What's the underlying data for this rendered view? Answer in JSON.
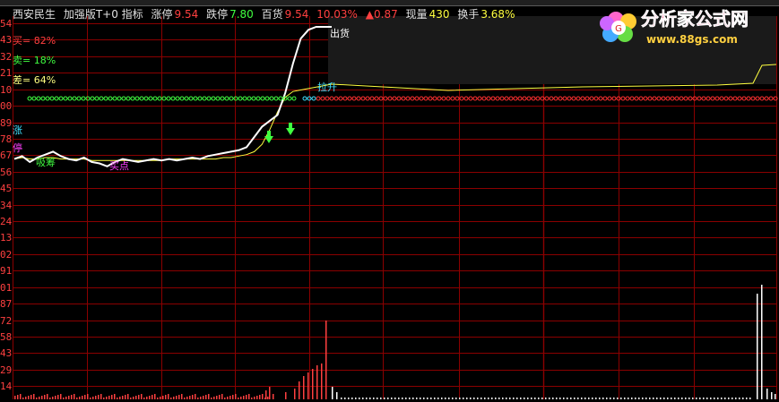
{
  "header": {
    "stock_name": "西安民生",
    "indicator_name": "加强版T+0 指标",
    "limit_up_label": "涨停",
    "limit_up_value": "9.54",
    "limit_down_label": "跌停",
    "limit_down_value": "7.80",
    "baihuo_label": "百货",
    "baihuo_price": "9.54",
    "change_pct": "10.03%",
    "change_value": "▲0.87",
    "volume_label": "现量",
    "volume_value": "430",
    "turnover_label": "换手",
    "turnover_value": "3.68%"
  },
  "indicators": {
    "buy": "买= 82%",
    "sell": "卖= 18%",
    "diff": "差= 64%"
  },
  "annotations": {
    "chuhuo": "出货",
    "lasheng": "拉升",
    "zhang": "涨",
    "ting": "停",
    "xishou": "吸筹",
    "maidian": "买点"
  },
  "logo": {
    "text": "分析家公式网",
    "url": "www.88gs.com"
  },
  "y_axis_labels": [
    "54",
    "43",
    "32",
    "21",
    "10",
    "00",
    "89",
    "78",
    "67",
    "56",
    "45",
    "34",
    "24",
    "13",
    "02",
    "91",
    "01",
    "87",
    "72",
    "58",
    "43",
    "29",
    "14"
  ],
  "colors": {
    "grid": "#8b0000",
    "price_line": "#ffffff",
    "avg_line": "#ffff40",
    "buy_color": "#ff4040",
    "sell_color": "#40ff40",
    "diff_color": "#ffff80",
    "cyan": "#40e0ff",
    "magenta": "#ff40ff"
  },
  "chart_data": {
    "type": "line",
    "price": [
      0.1,
      0.12,
      0.08,
      0.11,
      0.13,
      0.15,
      0.12,
      0.1,
      0.09,
      0.11,
      0.08,
      0.07,
      0.05,
      0.08,
      0.1,
      0.09,
      0.08,
      0.09,
      0.1,
      0.09,
      0.1,
      0.09,
      0.1,
      0.11,
      0.1,
      0.12,
      0.13,
      0.14,
      0.15,
      0.16,
      0.18,
      0.25,
      0.32,
      0.36,
      0.4,
      0.55,
      0.75,
      0.92,
      0.98,
      1.0,
      1.0,
      1.0
    ],
    "avg": [
      0.1,
      0.11,
      0.1,
      0.1,
      0.11,
      0.11,
      0.1,
      0.1,
      0.1,
      0.1,
      0.09,
      0.09,
      0.09,
      0.09,
      0.09,
      0.09,
      0.09,
      0.09,
      0.09,
      0.09,
      0.1,
      0.1,
      0.1,
      0.1,
      0.1,
      0.1,
      0.1,
      0.11,
      0.11,
      0.12,
      0.13,
      0.15,
      0.2,
      0.3,
      0.42,
      0.52,
      0.56,
      0.57,
      0.58,
      0.59,
      0.6,
      0.61
    ]
  }
}
